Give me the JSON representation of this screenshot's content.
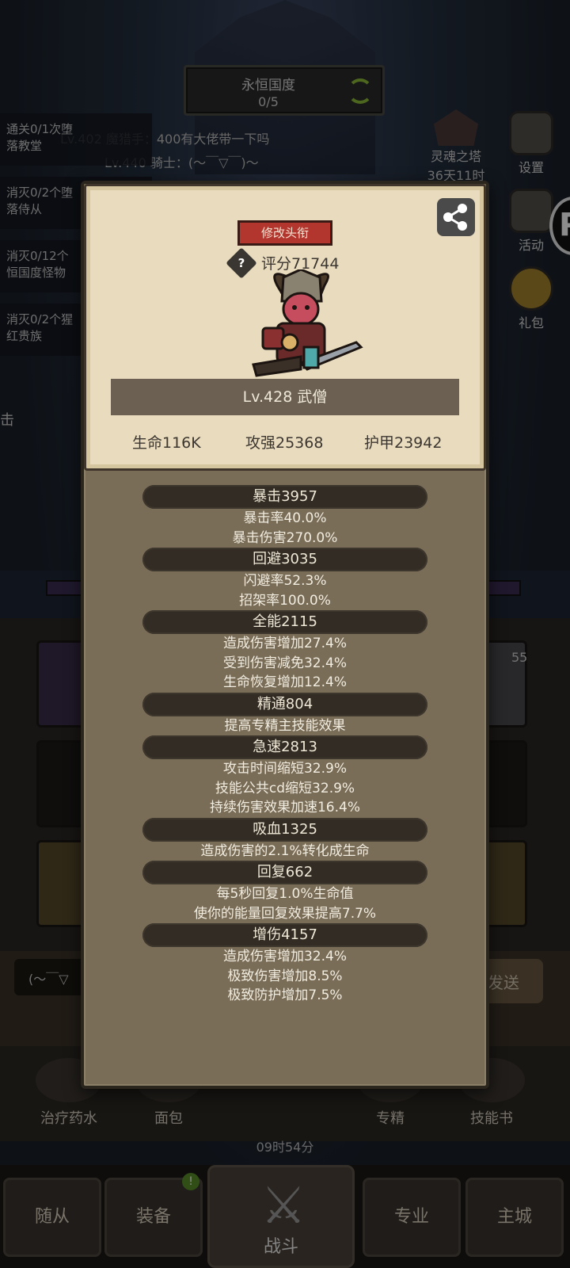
{
  "zone": {
    "name": "永恒国度",
    "progress": "0/5"
  },
  "chat": [
    {
      "text": "Lv.402 魔猎手：400有大佬带一下吗"
    },
    {
      "text": "Lv.440 骑士：(～￣▽￣)～"
    }
  ],
  "quests": [
    {
      "line1": "通关0/1次堕",
      "line2": "落教堂"
    },
    {
      "line1": "消灭0/2个堕",
      "line2": "落侍从"
    },
    {
      "line1": "消灭0/12个",
      "line2": "恒国度怪物"
    },
    {
      "line1": "消灭0/2个猩",
      "line2": "红贵族"
    }
  ],
  "soul_tower": {
    "label": "灵魂之塔",
    "timer": "36天11时"
  },
  "right_buttons": {
    "settings": "设置",
    "activity": "活动",
    "gift": "礼包"
  },
  "card": {
    "change_title": "修改头衔",
    "help": "?",
    "score": "评分71744",
    "name": "Lv.428 武僧",
    "hp": "生命116K",
    "attack": "攻强25368",
    "armor": "护甲23942"
  },
  "attributes": [
    {
      "name": "暴击3957",
      "lines": [
        "暴击率40.0%",
        "暴击伤害270.0%"
      ]
    },
    {
      "name": "回避3035",
      "lines": [
        "闪避率52.3%",
        "招架率100.0%"
      ]
    },
    {
      "name": "全能2115",
      "lines": [
        "造成伤害增加27.4%",
        "受到伤害减免32.4%",
        "生命恢复增加12.4%"
      ]
    },
    {
      "name": "精通804",
      "lines": [
        "提高专精主技能效果"
      ]
    },
    {
      "name": "急速2813",
      "lines": [
        "攻击时间缩短32.9%",
        "技能公共cd缩短32.9%",
        "持续伤害效果加速16.4%"
      ]
    },
    {
      "name": "吸血1325",
      "lines": [
        "造成伤害的2.1%转化成生命"
      ]
    },
    {
      "name": "回复662",
      "lines": [
        "每5秒回复1.0%生命值",
        "使你的能量回复效果提高7.7%"
      ]
    },
    {
      "name": "增伤4157",
      "lines": [
        "造成伤害增加32.4%",
        "极致伤害增加8.5%",
        "极致防护增加7.5%"
      ]
    }
  ],
  "background": {
    "slot_level": "55",
    "chat_input": "(～￣▽",
    "send": "发送",
    "partial_label": "击",
    "edge_letter": "P"
  },
  "items": {
    "potion": "治疗药水",
    "bread": "面包",
    "spec": "专精",
    "skill_book": "技能书",
    "timer": "09时54分"
  },
  "nav": {
    "followers": "随从",
    "equipment": "装备",
    "battle": "战斗",
    "profession": "专业",
    "main_city": "主城",
    "badge": "!"
  },
  "colors": {
    "card_bg": "#e9dcbe",
    "panel_bg": "#7a6d57",
    "title_btn": "#b3362e",
    "attr_head": "#322c24"
  },
  "icons": [
    "refresh-icon",
    "settings-gear-icon",
    "activity-icon",
    "gift-icon",
    "share-icon",
    "help-icon",
    "crossed-swords-icon"
  ]
}
